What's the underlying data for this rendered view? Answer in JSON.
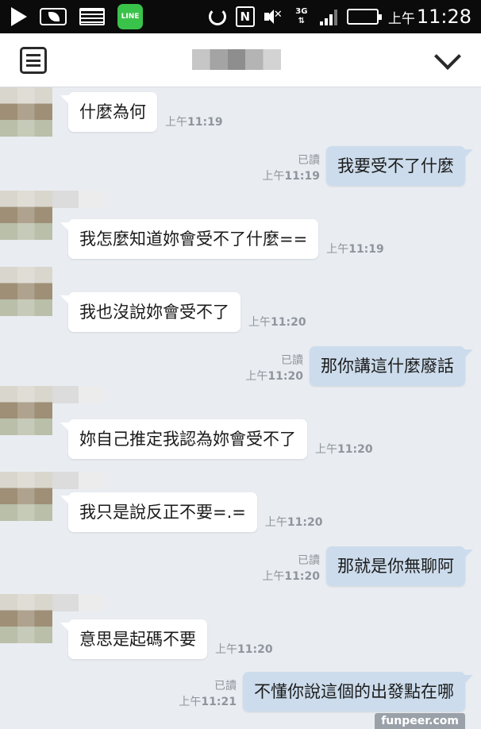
{
  "status_bar": {
    "ampm": "上午",
    "time": "11:28",
    "network": "3G",
    "line_label": "LINE",
    "nfc_label": "N",
    "icons": [
      "play-icon",
      "leaf-icon",
      "image-icon",
      "line-icon",
      "ring-icon",
      "nfc-icon",
      "mute-icon",
      "network-icon",
      "signal-icon",
      "battery-icon"
    ]
  },
  "header": {
    "menu_icon": "menu-icon",
    "collapse_icon": "chevron-down-icon"
  },
  "messages": [
    {
      "dir": "in",
      "text": "什麼為何",
      "ampm": "上午",
      "time": "11:19"
    },
    {
      "dir": "out",
      "text": "我要受不了什麼",
      "read": "已讀",
      "ampm": "上午",
      "time": "11:19"
    },
    {
      "dir": "in",
      "text": "我怎麼知道妳會受不了什麼==",
      "ampm": "上午",
      "time": "11:19"
    },
    {
      "dir": "in",
      "text": "我也沒說妳會受不了",
      "ampm": "上午",
      "time": "11:20"
    },
    {
      "dir": "out",
      "text": "那你講這什麼廢話",
      "read": "已讀",
      "ampm": "上午",
      "time": "11:20"
    },
    {
      "dir": "in",
      "text": "妳自己推定我認為妳會受不了",
      "ampm": "上午",
      "time": "11:20"
    },
    {
      "dir": "in",
      "text": "我只是說反正不要=.=",
      "ampm": "上午",
      "time": "11:20"
    },
    {
      "dir": "out",
      "text": "那就是你無聊阿",
      "read": "已讀",
      "ampm": "上午",
      "time": "11:20"
    },
    {
      "dir": "in",
      "text": "意思是起碼不要",
      "ampm": "上午",
      "time": "11:20"
    },
    {
      "dir": "out",
      "text": "不懂你說這個的出發點在哪",
      "read": "已讀",
      "ampm": "上午",
      "time": "11:21"
    }
  ],
  "watermark": "funpeer.com",
  "colors": {
    "background": "#e9edf2",
    "incoming_bubble": "#ffffff",
    "outgoing_bubble": "#ccdcec",
    "status_bar": "#0b0b0b",
    "line_green": "#3ac34a"
  }
}
